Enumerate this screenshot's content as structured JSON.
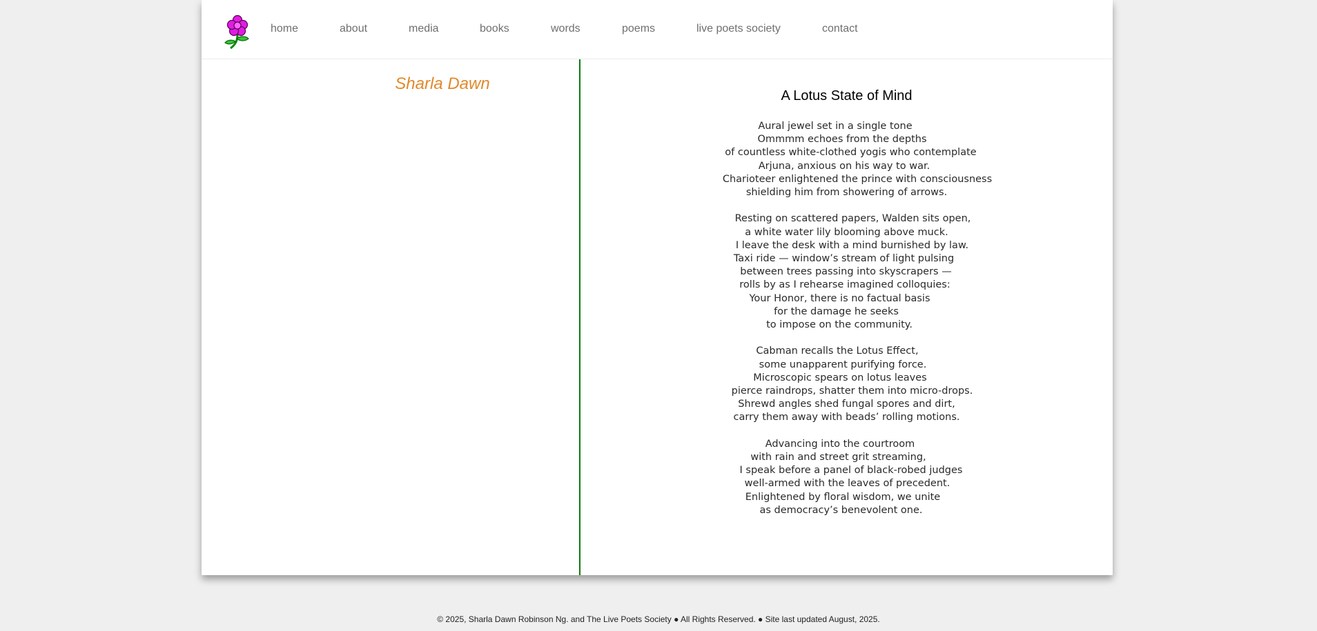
{
  "nav": {
    "items": [
      {
        "label": "home"
      },
      {
        "label": "about"
      },
      {
        "label": "media"
      },
      {
        "label": "books"
      },
      {
        "label": "words"
      },
      {
        "label": "poems"
      },
      {
        "label": "live poets society"
      },
      {
        "label": "contact"
      }
    ]
  },
  "left": {
    "author": "Sharla Dawn"
  },
  "poem": {
    "title": "A Lotus State of Mind",
    "stanzas": [
      [
        "Aural jewel set in a single tone",
        "Ommmm echoes from the depths",
        "of countless white-clothed yogis who contemplate",
        "Arjuna, anxious on his way to war.",
        "Charioteer enlightened the prince with consciousness",
        "shielding him from showering of arrows."
      ],
      [
        "Resting on scattered papers, Walden sits open,",
        "a white water lily blooming above muck.",
        "I leave the desk with a mind burnished by law.",
        "Taxi ride — window’s stream of light pulsing",
        "between trees passing into skyscrapers —",
        "rolls by as I rehearse imagined colloquies:",
        "Your Honor, there is no factual basis",
        "for the damage he seeks",
        "to impose on the community."
      ],
      [
        "Cabman recalls the Lotus Effect,",
        "some unapparent purifying force.",
        "Microscopic spears on lotus leaves",
        "pierce raindrops, shatter them into micro-drops.",
        "Shrewd angles shed fungal spores and dirt,",
        "carry them away with beads’ rolling motions."
      ],
      [
        "Advancing into the courtroom",
        "with rain and street grit streaming,",
        "I speak before a panel of black-robed judges",
        "well-armed with the leaves of precedent.",
        "Enlightened by floral wisdom, we unite",
        "as democracy’s benevolent one."
      ]
    ]
  },
  "footer": {
    "text": "© 2025, Sharla Dawn Robinson Ng. and The Live Poets Society ● All Rights Reserved. ● Site last updated August, 2025."
  },
  "colors": {
    "author": "#e08a2c",
    "divider": "#0d7a0d",
    "nav_text": "#6f6f6f",
    "background": "#efefef"
  }
}
